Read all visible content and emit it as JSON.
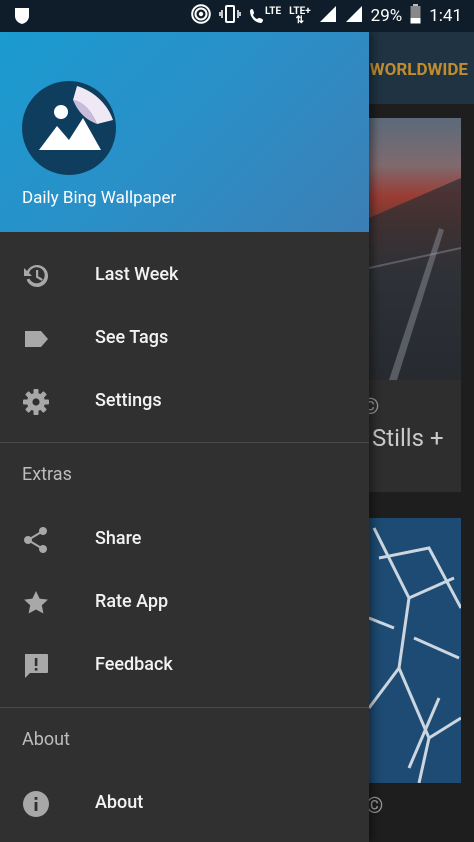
{
  "status_bar": {
    "lte1": "LTE",
    "lte2": "LTE+",
    "battery": "29%",
    "time": "1:41"
  },
  "background": {
    "region": "WORLDWIDE",
    "copyright_1": "©",
    "caption_1": "Stills +",
    "copyright_2": "©"
  },
  "drawer": {
    "app_name": "Daily Bing Wallpaper",
    "items": [
      {
        "label": "Last Week",
        "icon": "history-icon"
      },
      {
        "label": "See Tags",
        "icon": "tag-icon"
      },
      {
        "label": "Settings",
        "icon": "gear-icon"
      }
    ],
    "extras_header": "Extras",
    "extras": [
      {
        "label": "Share",
        "icon": "share-icon"
      },
      {
        "label": "Rate App",
        "icon": "star-icon"
      },
      {
        "label": "Feedback",
        "icon": "feedback-icon"
      }
    ],
    "about_header": "About",
    "about": [
      {
        "label": "About",
        "icon": "info-icon"
      }
    ]
  },
  "colors": {
    "header_start": "#1a9bd1",
    "drawer_bg": "#303030",
    "region_text": "#c08d2e"
  }
}
